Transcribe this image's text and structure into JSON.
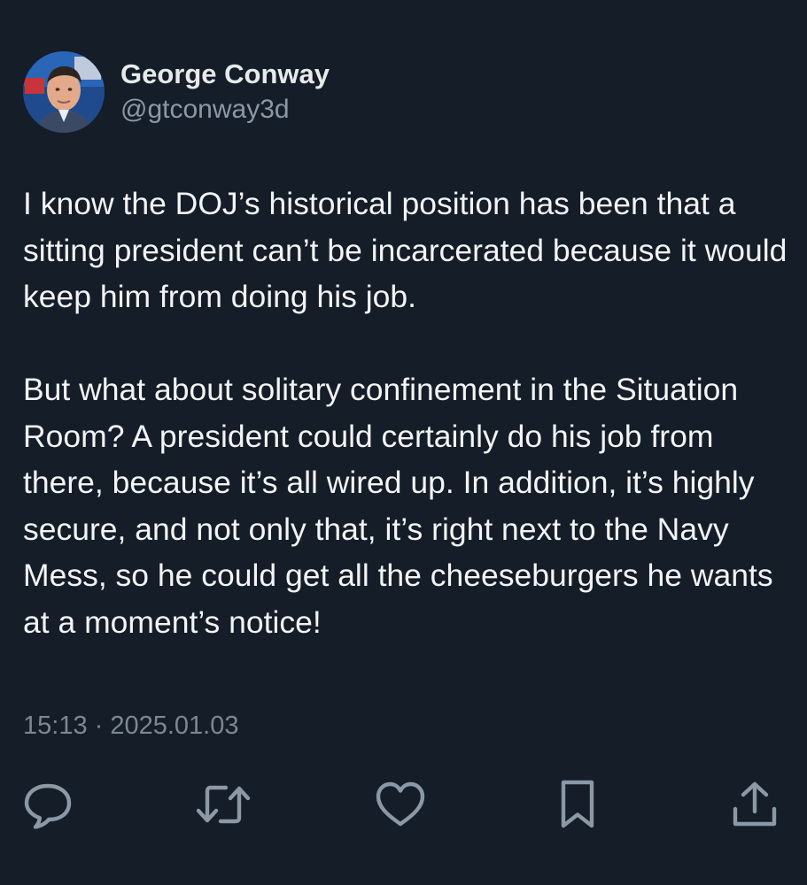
{
  "author": {
    "display_name": "George Conway",
    "handle": "@gtconway3d",
    "avatar_icon": "profile-photo"
  },
  "tweet": {
    "paragraph_1": "I know the DOJ’s historical position has been that a sitting president can’t be incarcerated because it would keep him from doing his job.",
    "paragraph_2": "But what about solitary confinement in the Situation Room?   A president could certainly do his job from there, because it’s all wired up.  In addition, it’s highly secure, and not only that, it’s right next to the Navy Mess, so he could get all the cheeseburgers he wants at a moment’s notice!"
  },
  "timestamp": "15:13 · 2025.01.03",
  "actions": [
    {
      "name": "reply",
      "icon": "speech-bubble-icon"
    },
    {
      "name": "retweet",
      "icon": "retweet-icon"
    },
    {
      "name": "like",
      "icon": "heart-icon"
    },
    {
      "name": "bookmark",
      "icon": "bookmark-icon"
    },
    {
      "name": "share",
      "icon": "share-icon"
    }
  ],
  "colors": {
    "background": "#151d28",
    "text": "#e7e9ea",
    "secondary_text": "#8b98a5",
    "icon": "#8b98a5"
  }
}
